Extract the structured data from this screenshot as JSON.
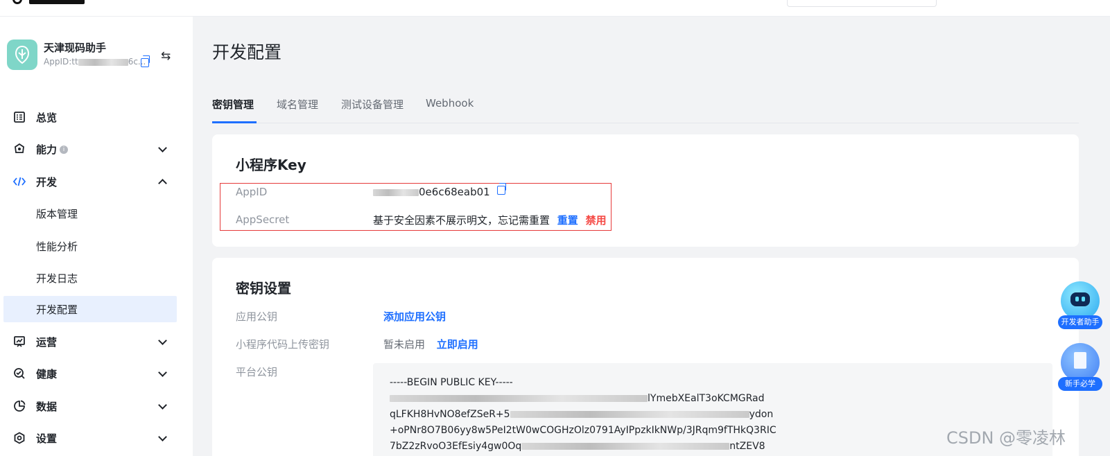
{
  "app": {
    "name": "天津现码助手",
    "appid_prefix": "AppID:tt",
    "appid_suffix": "6c..."
  },
  "sidebar": {
    "items": [
      {
        "label": "总览",
        "icon": "dashboard-icon",
        "expandable": false
      },
      {
        "label": "能力",
        "icon": "capability-icon",
        "expandable": true,
        "expanded": false,
        "info": "i"
      },
      {
        "label": "开发",
        "icon": "code-icon",
        "expandable": true,
        "expanded": true
      },
      {
        "label": "运营",
        "icon": "operation-icon",
        "expandable": true,
        "expanded": false
      },
      {
        "label": "健康",
        "icon": "health-icon",
        "expandable": true,
        "expanded": false
      },
      {
        "label": "数据",
        "icon": "chart-pie-icon",
        "expandable": true,
        "expanded": false
      },
      {
        "label": "设置",
        "icon": "settings-icon",
        "expandable": true,
        "expanded": false
      }
    ],
    "dev_subitems": [
      "版本管理",
      "性能分析",
      "开发日志",
      "开发配置"
    ],
    "active_subitem": "开发配置"
  },
  "page": {
    "title": "开发配置",
    "tabs": [
      "密钥管理",
      "域名管理",
      "测试设备管理",
      "Webhook"
    ],
    "active_tab": "密钥管理"
  },
  "key_card": {
    "title": "小程序Key",
    "appid_label": "AppID",
    "appid_value_suffix": "0e6c68eab01",
    "secret_label": "AppSecret",
    "secret_text": "基于安全因素不展示明文，忘记需重置",
    "reset_label": "重置",
    "disable_label": "禁用"
  },
  "secret_card": {
    "title": "密钥设置",
    "app_pubkey_label": "应用公钥",
    "app_pubkey_action": "添加应用公钥",
    "upload_key_label": "小程序代码上传密钥",
    "upload_key_status": "暂未启用",
    "upload_key_action": "立即启用",
    "platform_pubkey_label": "平台公钥",
    "key_lines": [
      "-----BEGIN PUBLIC KEY-----",
      "lYmebXEalT3oKCMGRad",
      "qLFKH8HvNO8efZSeR+5",
      "ydon",
      "+oPNr8O7B06yy8w5PeI2tW0wCOGHzOlz0791AyIPpzkIkNWp/3JRqm9fTHkQ3RIC",
      "7bZ2zRvoO3EfEsiy4gw0Oq",
      "ntZEV8"
    ]
  },
  "floating": {
    "assistant_label": "开发者助手",
    "guide_label": "新手必学"
  },
  "watermark": "CSDN @零凌林",
  "colors": {
    "accent": "#1e6fff",
    "danger": "#f54a45",
    "highlight_border": "#e63a3a",
    "app_icon_bg": "#7fd6c8"
  }
}
